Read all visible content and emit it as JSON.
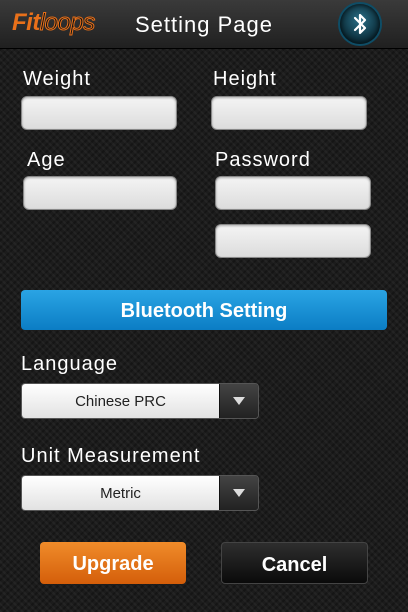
{
  "header": {
    "logo_fit": "Fit",
    "logo_loops": "loops",
    "title": "Setting Page",
    "bluetooth_icon": "bluetooth-icon"
  },
  "form": {
    "weight_label": "Weight",
    "weight_value": "",
    "height_label": "Height",
    "height_value": "",
    "age_label": "Age",
    "age_value": "",
    "password_label": "Password",
    "password_value": "",
    "password_confirm_value": ""
  },
  "bluetooth_setting_label": "Bluetooth Setting",
  "language": {
    "label": "Language",
    "selected": "Chinese PRC"
  },
  "unit": {
    "label": "Unit Measurement",
    "selected": "Metric"
  },
  "actions": {
    "upgrade_label": "Upgrade",
    "cancel_label": "Cancel"
  },
  "colors": {
    "accent_blue": "#1a90d4",
    "accent_orange": "#e8701a"
  }
}
